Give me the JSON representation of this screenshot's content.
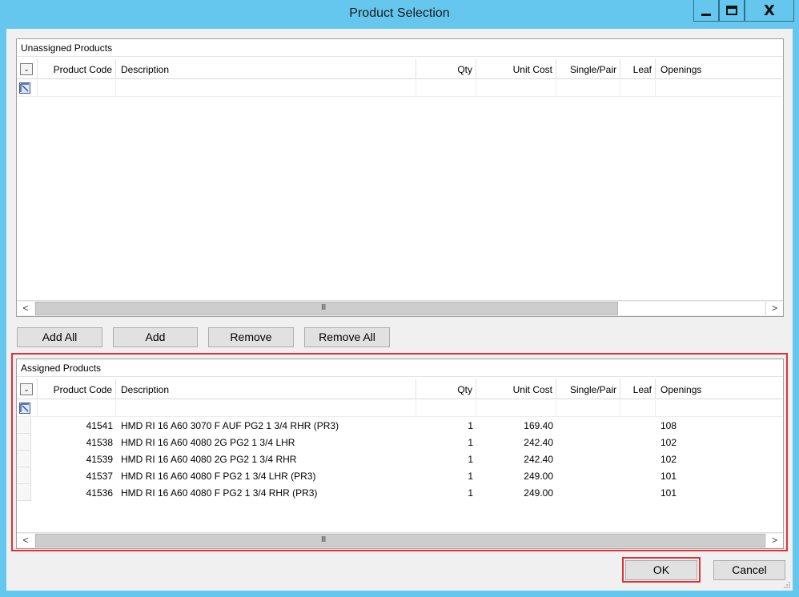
{
  "window": {
    "title": "Product Selection",
    "minimize_icon": "minimize-icon",
    "maximize_icon": "maximize-icon",
    "close_icon": "close-icon"
  },
  "columns": {
    "product_code": "Product Code",
    "description": "Description",
    "qty": "Qty",
    "unit_cost": "Unit Cost",
    "single_pair": "Single/Pair",
    "leaf": "Leaf",
    "openings": "Openings"
  },
  "unassigned": {
    "title": "Unassigned Products",
    "rows": []
  },
  "buttons": {
    "add_all": "Add All",
    "add": "Add",
    "remove": "Remove",
    "remove_all": "Remove All",
    "ok": "OK",
    "cancel": "Cancel"
  },
  "assigned": {
    "title": "Assigned Products",
    "rows": [
      {
        "product_code": "41541",
        "description": "HMD RI 16 A60 3070 F AUF PG2 1 3/4 RHR (PR3)",
        "qty": "1",
        "unit_cost": "169.40",
        "single_pair": "",
        "leaf": "",
        "openings": "108"
      },
      {
        "product_code": "41538",
        "description": "HMD RI 16 A60 4080 2G PG2 1 3/4 LHR",
        "qty": "1",
        "unit_cost": "242.40",
        "single_pair": "",
        "leaf": "",
        "openings": "102"
      },
      {
        "product_code": "41539",
        "description": "HMD RI 16 A60 4080 2G PG2 1 3/4 RHR",
        "qty": "1",
        "unit_cost": "242.40",
        "single_pair": "",
        "leaf": "",
        "openings": "102"
      },
      {
        "product_code": "41537",
        "description": "HMD RI 16 A60 4080 F PG2 1 3/4 LHR (PR3)",
        "qty": "1",
        "unit_cost": "249.00",
        "single_pair": "",
        "leaf": "",
        "openings": "101"
      },
      {
        "product_code": "41536",
        "description": "HMD RI 16 A60 4080 F PG2 1 3/4 RHR (PR3)",
        "qty": "1",
        "unit_cost": "249.00",
        "single_pair": "",
        "leaf": "",
        "openings": "101"
      }
    ]
  },
  "scrollbar": {
    "left_arrow": "<",
    "right_arrow": ">",
    "grip": "III"
  },
  "colors": {
    "title_bar": "#65c7ee",
    "highlight": "#e0313b"
  }
}
